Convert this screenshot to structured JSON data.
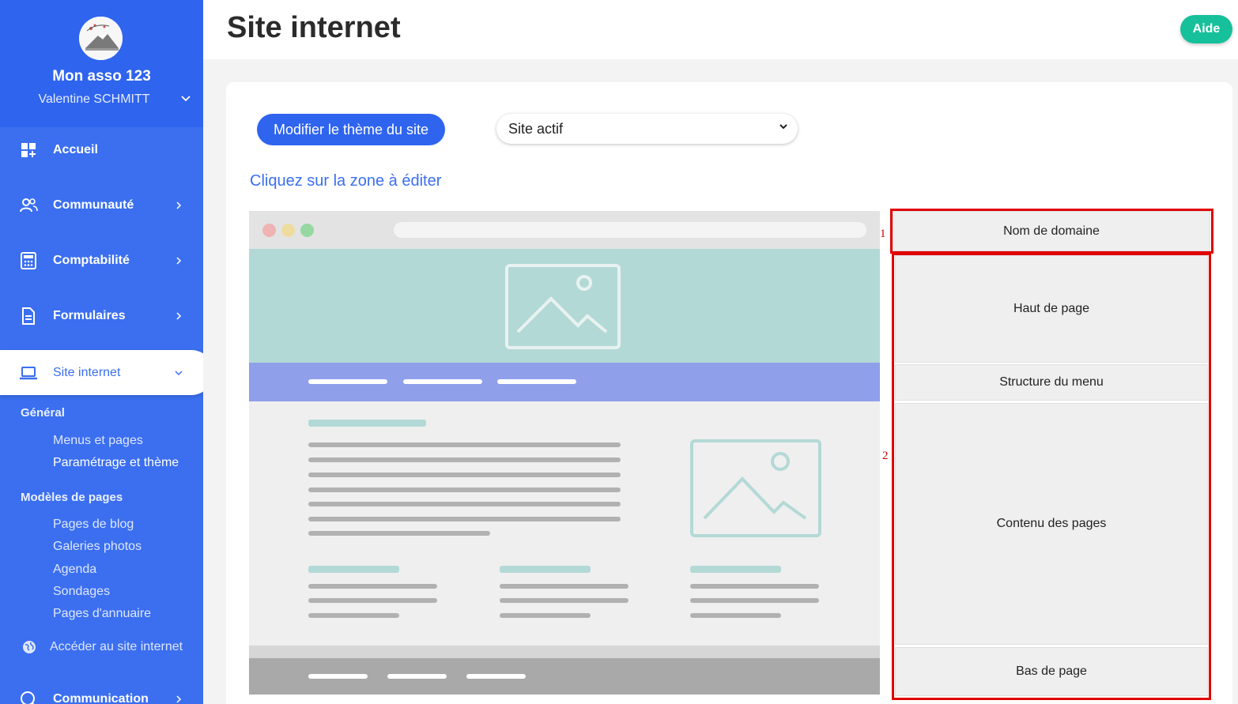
{
  "sidebar": {
    "org_name": "Mon asso 123",
    "user_name": "Valentine SCHMITT",
    "nav": [
      {
        "label": "Accueil",
        "icon": "dashboard-icon"
      },
      {
        "label": "Communauté",
        "icon": "community-icon"
      },
      {
        "label": "Comptabilité",
        "icon": "calculator-icon"
      },
      {
        "label": "Formulaires",
        "icon": "document-icon"
      },
      {
        "label": "Site internet",
        "icon": "laptop-icon",
        "active": true
      },
      {
        "label": "Communication",
        "icon": "communication-icon"
      }
    ],
    "sections": [
      {
        "title": "Général",
        "links": [
          "Menus et pages",
          "Paramétrage et thème"
        ]
      },
      {
        "title": "Modèles de pages",
        "links": [
          "Pages de blog",
          "Galeries photos",
          "Agenda",
          "Sondages",
          "Pages d'annuaire"
        ]
      }
    ],
    "external_link": "Accéder au site internet"
  },
  "header": {
    "title": "Site internet",
    "help_label": "Aide"
  },
  "main": {
    "theme_button": "Modifier le thème du site",
    "select_value": "Site actif",
    "hint": "Cliquez sur la zone à éditer",
    "zones": [
      "Nom de domaine",
      "Haut de page",
      "Structure du menu",
      "Contenu des pages",
      "Bas de page"
    ],
    "markers": [
      "1",
      "2"
    ]
  },
  "colors": {
    "primary": "#3b6ff0",
    "accent_green": "#16c09a",
    "highlight_red": "#e00000",
    "hero_teal": "#b3d9d6",
    "menu_purple": "#8f9fea"
  }
}
